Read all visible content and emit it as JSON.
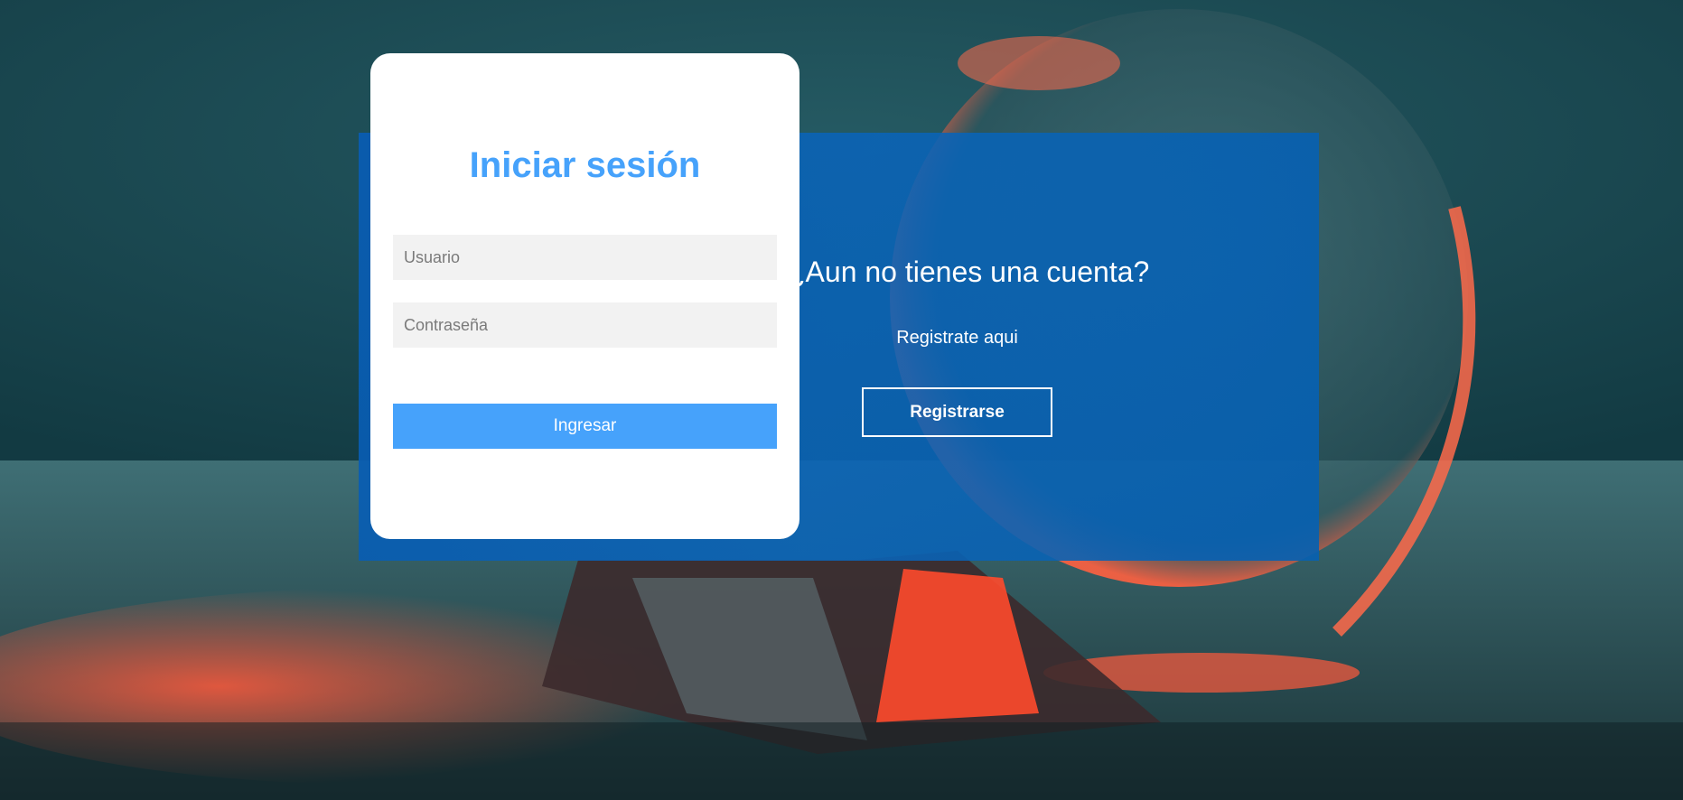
{
  "login": {
    "title": "Iniciar sesión",
    "username_placeholder": "Usuario",
    "password_placeholder": "Contraseña",
    "submit_label": "Ingresar"
  },
  "register": {
    "title": "¿Aun no tienes una cuenta?",
    "text": "Registrate aqui",
    "button_label": "Registrarse"
  },
  "colors": {
    "accent": "#46a2fb",
    "panel_blue": "#0a64b8",
    "background": "#16414a"
  }
}
